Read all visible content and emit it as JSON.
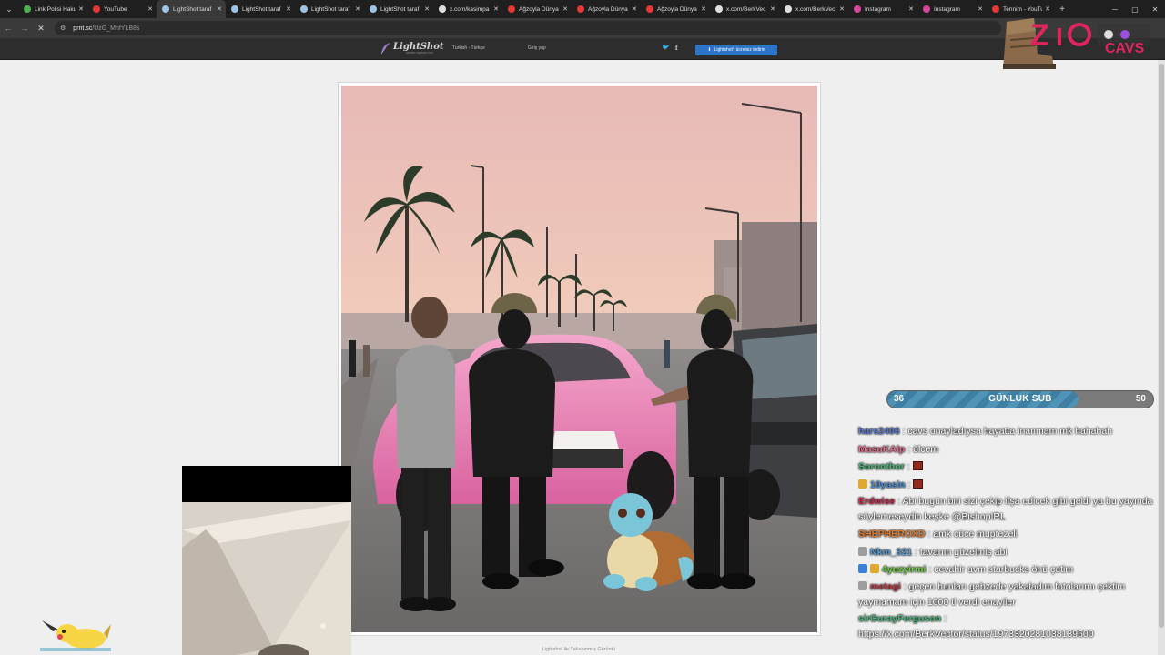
{
  "tabs": [
    {
      "label": "Link Polisi Haku",
      "fav": "#4caf50",
      "active": false,
      "w": 76
    },
    {
      "label": "YouTube",
      "fav": "#e53935",
      "active": false,
      "w": 76
    },
    {
      "label": "LightShot taraf",
      "fav": "#9ec5e8",
      "active": true,
      "w": 76
    },
    {
      "label": "LightShot taraf",
      "fav": "#9ec5e8",
      "active": false,
      "w": 76
    },
    {
      "label": "LightShot taraf",
      "fav": "#9ec5e8",
      "active": false,
      "w": 76
    },
    {
      "label": "LightShot taraf",
      "fav": "#9ec5e8",
      "active": false,
      "w": 76
    },
    {
      "label": "x.com/kasimpa",
      "fav": "#e0e0e0",
      "active": false,
      "w": 76
    },
    {
      "label": "Ağzoyla Dünya",
      "fav": "#e53935",
      "active": false,
      "w": 76
    },
    {
      "label": "Ağzoyla Dünya",
      "fav": "#e53935",
      "active": false,
      "w": 76
    },
    {
      "label": "Ağzoyla Dünya",
      "fav": "#e53935",
      "active": false,
      "w": 76
    },
    {
      "label": "x.com/BerkVec",
      "fav": "#e0e0e0",
      "active": false,
      "w": 76
    },
    {
      "label": "x.com/BerkVec",
      "fav": "#e0e0e0",
      "active": false,
      "w": 76
    },
    {
      "label": "Instagram",
      "fav": "#d6479b",
      "active": false,
      "w": 76
    },
    {
      "label": "Instagram",
      "fav": "#d6479b",
      "active": false,
      "w": 76
    },
    {
      "label": "Tennim - YouTu",
      "fav": "#e53935",
      "active": false,
      "w": 74
    }
  ],
  "address": {
    "host": "prnt.sc",
    "path": "/UzG_MhfYLB8s"
  },
  "lightshot": {
    "logo": "LightShot",
    "logo_sub": "screen capture tool",
    "lang": "Turkish - Türkçe",
    "login": "Giriş yap",
    "download": "Lightshot'ı ücretsiz indirin",
    "caption": "Lightshot ile Yakalanmış Görüntü"
  },
  "overlay": {
    "sub_goal": {
      "label": "GÜNLUK SUB",
      "current": 36,
      "goal": 50,
      "fill_fraction": 0.72
    }
  },
  "chat": [
    {
      "user": "hars2406",
      "color": "#5f79d1",
      "text": "cavs onayladıysa hayatta inanmam mk hahahah",
      "badges": []
    },
    {
      "user": "MasuKAlp",
      "color": "#e06b8a",
      "text": "ölcem",
      "badges": []
    },
    {
      "user": "Soronthor",
      "color": "#48b57a",
      "text": "",
      "badges": [],
      "emote": true
    },
    {
      "user": "10yasin",
      "color": "#4a8ed8",
      "text": "",
      "badges": [
        "#e0a82e"
      ],
      "emote": true
    },
    {
      "user": "Erdwise",
      "color": "#c92a4f",
      "text": "Abi bugün biri sizi çekip ifşa edicek gibi geldi ya bu yayında söylemeseydin keşke @BishopIRL",
      "badges": [],
      "wrap": true
    },
    {
      "user": "SHEPHEROXD",
      "color": "#e37b2a",
      "text": "amk cüce muptezeli",
      "badges": []
    },
    {
      "user": "Nkm_321",
      "color": "#5aa0d8",
      "text": "tavanın güzelmiş abi",
      "badges": [
        "#9e9e9e"
      ]
    },
    {
      "user": "4yuzyirmi",
      "color": "#6bd13a",
      "text": "cevahir avm starbucks önü çetim",
      "badges": [
        "#3b82d6",
        "#e0a82e"
      ]
    },
    {
      "user": "metagi",
      "color": "#c43a4a",
      "text": "geçen bunları gebzede yakaladım fotolarımı çektim yaymamam için 1000 tl verdi enayiler",
      "badges": [
        "#9e9e9e"
      ],
      "wrap": true
    },
    {
      "user": "sirGurayFerguson",
      "color": "#48b57a",
      "text": "https://x.com/BerkVector/status/1973320281038139600",
      "badges": [],
      "wrap": true
    }
  ]
}
